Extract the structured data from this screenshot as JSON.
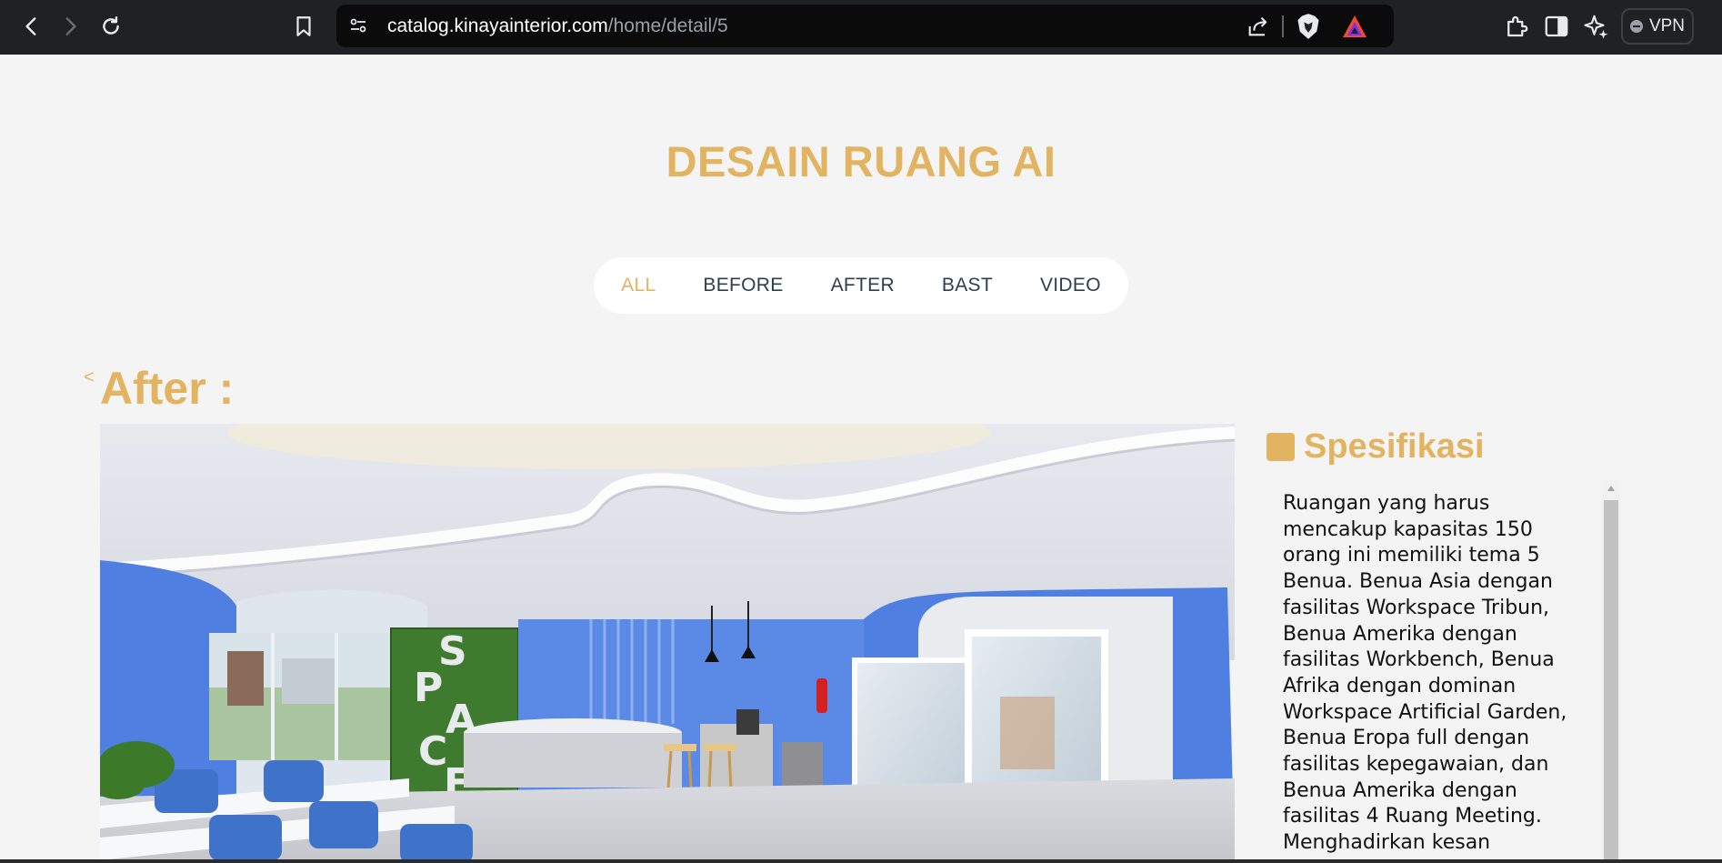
{
  "browser": {
    "url_host": "catalog.kinayainterior.com",
    "url_path": "/home/detail/5",
    "vpn_label": "VPN",
    "icons": [
      "back-icon",
      "forward-icon",
      "reload-icon",
      "bookmark-icon",
      "site-settings-icon",
      "share-icon",
      "brave-shields-icon",
      "brave-rewards-icon",
      "extensions-icon",
      "sidebar-icon",
      "leo-ai-icon"
    ]
  },
  "page": {
    "title": "DESAIN RUANG AI",
    "tabs": [
      {
        "label": "ALL",
        "active": true
      },
      {
        "label": "BEFORE",
        "active": false
      },
      {
        "label": "AFTER",
        "active": false
      },
      {
        "label": "BAST",
        "active": false
      },
      {
        "label": "VIDEO",
        "active": false
      }
    ],
    "back_arrow": "<",
    "section_label": "After :",
    "photo_sign_letters": "SPACE",
    "spec": {
      "title": "Spesifikasi",
      "text": "Ruangan yang harus mencakup kapasitas 150 orang ini memiliki tema 5 Benua. Benua Asia dengan fasilitas Workspace Tribun, Benua Amerika dengan fasilitas Workbench, Benua Afrika dengan dominan Workspace Artificial Garden, Benua Eropa full dengan fasilitas kepegawaian, dan Benua Amerika dengan fasilitas 4 Ruang Meeting. Menghadirkan kesan nyaman"
    }
  },
  "colors": {
    "accent": "#e2b462",
    "page_bg": "#f3f4f3",
    "chrome_bg": "#202124",
    "tab_text": "#2c3e50"
  }
}
